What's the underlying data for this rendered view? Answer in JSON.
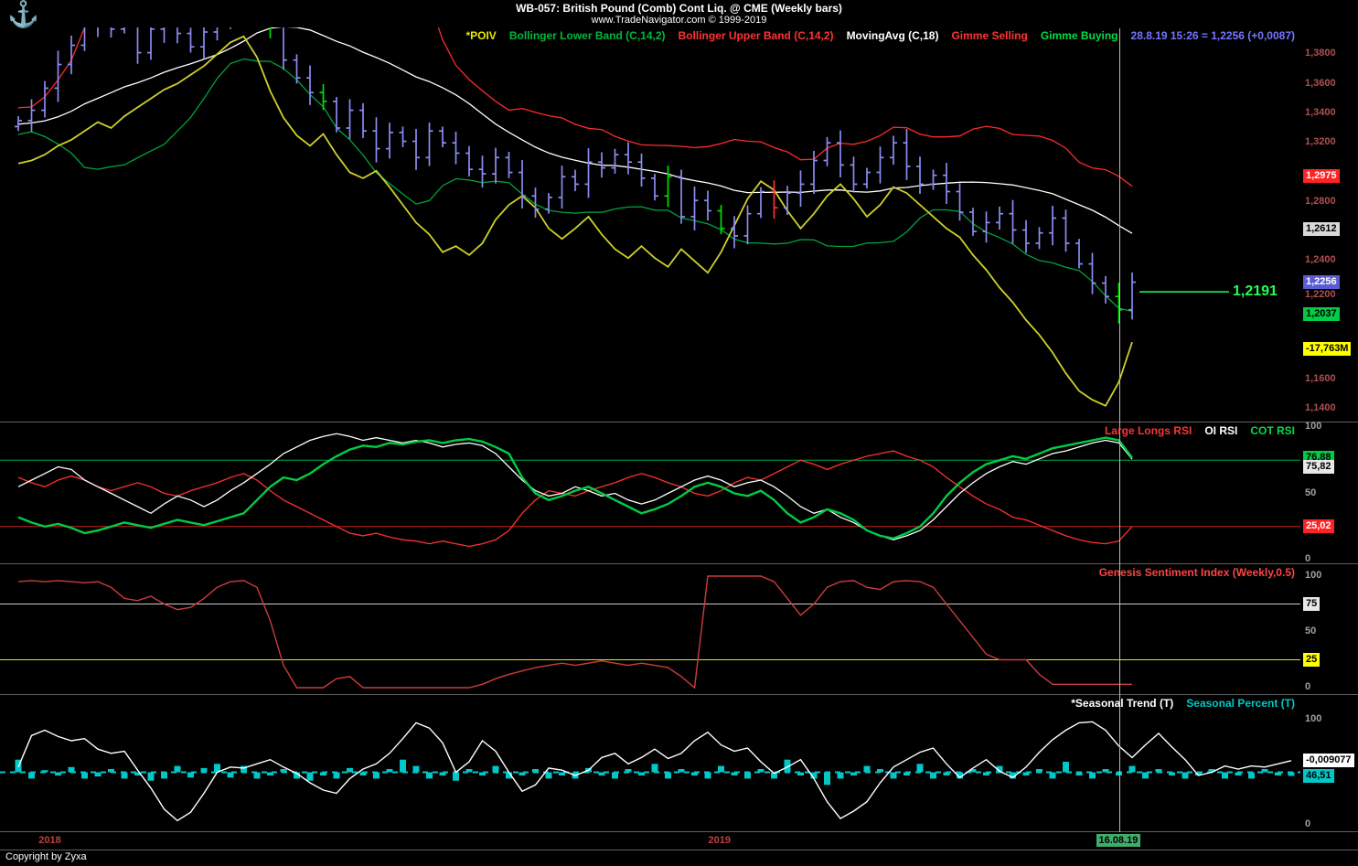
{
  "header": {
    "title": "WB-057:  British Pound (Comb) Cont Liq. @ CME  (Weekly bars)",
    "subtitle": "www.TradeNavigator.com © 1999-2019",
    "logo_glyph": "⚓"
  },
  "footer": {
    "copyright": "Copyright by Zyxa"
  },
  "x_axis": {
    "year_color": "#c04040",
    "years": [
      {
        "label": "2018",
        "index": 2.5
      },
      {
        "label": "2019",
        "index": 53
      }
    ],
    "cursor": {
      "label": "16.08.19",
      "index": 83,
      "badge_bg": "#3fae6a",
      "badge_fg": "#000000"
    }
  },
  "chart_data": [
    {
      "id": "price",
      "type": "ohlc",
      "title": "British Pound (Comb) Cont Liq. weekly bars with POIV, Bollinger Bands, MovingAvg, Gimme signals",
      "ylim": [
        1.135,
        1.395
      ],
      "legend": [
        {
          "label": "*POIV",
          "color": "#e8e800"
        },
        {
          "label": "Bollinger Lower Band (C,14,2)",
          "color": "#00b83c"
        },
        {
          "label": "Bollinger Upper Band (C,14,2)",
          "color": "#ff3333"
        },
        {
          "label": "MovingAvg (C,18)",
          "color": "#ffffff"
        },
        {
          "label": "Gimme Selling",
          "color": "#ff3333"
        },
        {
          "label": "Gimme Buying",
          "color": "#00dd44"
        },
        {
          "label": "28.8.19 15:26 = 1,2256 (+0,0087)",
          "color": "#7575ff"
        }
      ],
      "bar_color": "#8c8cf2",
      "buy_color": "#00e000",
      "sell_color": "#ff3232",
      "pre_closes": [
        1.322,
        1.327,
        1.331,
        1.324,
        1.319,
        1.326,
        1.332,
        1.328,
        1.335,
        1.33,
        1.338,
        1.334,
        1.34,
        1.336,
        1.339,
        1.343,
        1.333,
        1.337
      ],
      "closes": [
        1.335,
        1.342,
        1.357,
        1.373,
        1.386,
        1.416,
        1.4,
        1.397,
        1.405,
        1.381,
        1.397,
        1.403,
        1.394,
        1.385,
        1.395,
        1.4,
        1.409,
        1.424,
        1.434,
        1.4,
        1.376,
        1.364,
        1.354,
        1.348,
        1.33,
        1.342,
        1.328,
        1.316,
        1.327,
        1.321,
        1.31,
        1.328,
        1.32,
        1.313,
        1.302,
        1.299,
        1.31,
        1.3,
        1.284,
        1.275,
        1.283,
        1.297,
        1.292,
        1.307,
        1.303,
        1.312,
        1.307,
        1.296,
        1.284,
        1.297,
        1.27,
        1.281,
        1.274,
        1.262,
        1.257,
        1.272,
        1.287,
        1.276,
        1.286,
        1.292,
        1.308,
        1.32,
        1.305,
        1.292,
        1.3,
        1.31,
        1.32,
        1.304,
        1.292,
        1.298,
        1.287,
        1.273,
        1.26,
        1.266,
        1.272,
        1.261,
        1.252,
        1.259,
        1.269,
        1.252,
        1.238,
        1.225,
        1.216,
        1.207,
        1.2256
      ],
      "signals": {
        "buy": [
          19,
          23,
          49,
          53,
          83
        ],
        "sell": [
          57
        ]
      },
      "series": [
        {
          "name": "*POIV",
          "color": "#cfcf2a",
          "values": [
            1.306,
            1.308,
            1.312,
            1.318,
            1.322,
            1.328,
            1.334,
            1.33,
            1.338,
            1.344,
            1.35,
            1.356,
            1.36,
            1.366,
            1.372,
            1.38,
            1.388,
            1.392,
            1.378,
            1.355,
            1.337,
            1.325,
            1.318,
            1.326,
            1.312,
            1.3,
            1.296,
            1.301,
            1.29,
            1.278,
            1.266,
            1.258,
            1.246,
            1.25,
            1.244,
            1.252,
            1.268,
            1.278,
            1.284,
            1.276,
            1.262,
            1.255,
            1.262,
            1.27,
            1.258,
            1.248,
            1.242,
            1.25,
            1.242,
            1.236,
            1.248,
            1.24,
            1.232,
            1.246,
            1.264,
            1.282,
            1.294,
            1.288,
            1.274,
            1.262,
            1.272,
            1.284,
            1.292,
            1.282,
            1.27,
            1.278,
            1.29,
            1.286,
            1.278,
            1.27,
            1.262,
            1.256,
            1.244,
            1.234,
            1.222,
            1.212,
            1.2,
            1.19,
            1.178,
            1.164,
            1.152,
            1.146,
            1.142,
            1.158,
            1.185
          ]
        },
        {
          "name": "MovingAvg (C,18)",
          "color": "#ffffff",
          "derived": "sma",
          "period": 18
        },
        {
          "name": "Bollinger Upper Band (C,14,2)",
          "color": "#ff2a2a",
          "derived": "bollinger_upper",
          "period": 14,
          "mult": 2
        },
        {
          "name": "Bollinger Lower Band (C,14,2)",
          "color": "#00a33c",
          "derived": "bollinger_lower",
          "period": 14,
          "mult": 2
        }
      ],
      "hline": {
        "value": 1.2191,
        "label": "1,2191",
        "color": "#22ff55"
      },
      "axis": {
        "plain_color": "#b05050",
        "plain": [
          {
            "t": "1,3800",
            "v": 1.38
          },
          {
            "t": "1,3600",
            "v": 1.36
          },
          {
            "t": "1,3400",
            "v": 1.34
          },
          {
            "t": "1,3200",
            "v": 1.32
          },
          {
            "t": "1,2800",
            "v": 1.28
          },
          {
            "t": "1,2400",
            "v": 1.24
          },
          {
            "t": "1,2200",
            "v": 1.22,
            "dy": 5
          },
          {
            "t": "1,1600",
            "v": 1.16
          },
          {
            "t": "1,1400",
            "v": 1.14
          }
        ],
        "badges": [
          {
            "t": "1,2975",
            "v": 1.2975,
            "bg": "#ff2222",
            "fg": "#ffffff"
          },
          {
            "t": "1,2612",
            "v": 1.2612,
            "bg": "#d8d8d8",
            "fg": "#000000"
          },
          {
            "t": "1,2256",
            "v": 1.2256,
            "bg": "#5b5bd6",
            "fg": "#ffffff"
          },
          {
            "t": "1,2037",
            "v": 1.2037,
            "bg": "#00cc44",
            "fg": "#000000"
          },
          {
            "t": "-17,763M",
            "v": 1.1805,
            "bg": "#ffff00",
            "fg": "#000000"
          }
        ]
      }
    },
    {
      "id": "rsi",
      "type": "line",
      "ylim": [
        0,
        100
      ],
      "legend": [
        {
          "label": "Large Longs RSI",
          "color": "#ff3333"
        },
        {
          "label": "OI RSI",
          "color": "#ffffff"
        },
        {
          "label": "COT RSI",
          "color": "#00dd44"
        }
      ],
      "series": [
        {
          "name": "Large Longs RSI",
          "color": "#ff3030",
          "width": 1.3,
          "values": [
            62,
            58,
            55,
            60,
            63,
            60,
            55,
            52,
            55,
            58,
            55,
            50,
            48,
            52,
            55,
            58,
            62,
            65,
            60,
            52,
            45,
            40,
            35,
            30,
            25,
            20,
            18,
            20,
            17,
            15,
            14,
            12,
            14,
            12,
            10,
            12,
            15,
            22,
            35,
            45,
            52,
            50,
            48,
            52,
            55,
            58,
            62,
            65,
            62,
            58,
            55,
            50,
            48,
            52,
            58,
            62,
            60,
            65,
            70,
            75,
            72,
            68,
            72,
            75,
            78,
            80,
            82,
            78,
            75,
            70,
            62,
            55,
            48,
            42,
            38,
            32,
            30,
            26,
            22,
            18,
            15,
            13,
            12,
            14,
            25.02
          ]
        },
        {
          "name": "OI RSI",
          "color": "#ffffff",
          "width": 1.3,
          "values": [
            55,
            60,
            65,
            70,
            68,
            60,
            55,
            50,
            45,
            40,
            35,
            42,
            48,
            45,
            40,
            45,
            52,
            58,
            65,
            72,
            80,
            85,
            90,
            93,
            95,
            93,
            90,
            92,
            90,
            88,
            90,
            88,
            85,
            87,
            88,
            86,
            80,
            70,
            60,
            52,
            48,
            50,
            55,
            52,
            48,
            50,
            45,
            42,
            45,
            50,
            55,
            60,
            63,
            60,
            55,
            58,
            60,
            55,
            48,
            40,
            35,
            38,
            32,
            28,
            22,
            18,
            15,
            18,
            22,
            30,
            40,
            50,
            58,
            65,
            70,
            74,
            72,
            76,
            80,
            82,
            85,
            88,
            90,
            88,
            75.82
          ]
        },
        {
          "name": "COT RSI",
          "color": "#00cc44",
          "width": 2.4,
          "values": [
            32,
            28,
            25,
            27,
            24,
            20,
            22,
            25,
            28,
            26,
            24,
            27,
            30,
            28,
            26,
            29,
            32,
            35,
            45,
            55,
            62,
            60,
            65,
            72,
            78,
            83,
            86,
            85,
            88,
            87,
            89,
            90,
            88,
            90,
            91,
            89,
            85,
            80,
            62,
            50,
            45,
            48,
            52,
            55,
            50,
            45,
            40,
            35,
            38,
            42,
            48,
            55,
            58,
            55,
            50,
            48,
            52,
            45,
            35,
            28,
            32,
            38,
            35,
            30,
            22,
            18,
            16,
            20,
            25,
            35,
            48,
            58,
            66,
            72,
            75,
            78,
            76,
            80,
            84,
            86,
            88,
            90,
            92,
            90,
            76.88
          ]
        }
      ],
      "hlines": [
        {
          "v": 75,
          "color": "#00aa44"
        },
        {
          "v": 25,
          "color": "#cc2222"
        }
      ],
      "axis": {
        "plain_color": "#a0a0a0",
        "plain": [
          {
            "t": "100",
            "v": 100
          },
          {
            "t": "50",
            "v": 50
          },
          {
            "t": "0",
            "v": 0
          }
        ],
        "badges": [
          {
            "t": "76,88",
            "v": 76.88,
            "bg": "#00cc44",
            "fg": "#000000"
          },
          {
            "t": "75,82",
            "v": 75.82,
            "bg": "#e8e8e8",
            "fg": "#000000",
            "dy": 9
          },
          {
            "t": "25,02",
            "v": 25.02,
            "bg": "#ff2222",
            "fg": "#ffffff"
          }
        ]
      }
    },
    {
      "id": "sentiment",
      "type": "line",
      "ylim": [
        0,
        100
      ],
      "legend": [
        {
          "label": "Genesis Sentiment Index (Weekly,0.5)",
          "color": "#ff4444"
        }
      ],
      "series": [
        {
          "name": "Genesis Sentiment Index (Weekly,0.5)",
          "color": "#cc3c3c",
          "width": 1.4,
          "values": [
            95,
            96,
            95,
            96,
            95,
            94,
            95,
            90,
            80,
            78,
            82,
            75,
            70,
            72,
            80,
            90,
            95,
            96,
            90,
            60,
            20,
            0,
            0,
            0,
            8,
            10,
            0,
            0,
            0,
            0,
            0,
            0,
            0,
            0,
            0,
            3,
            8,
            12,
            15,
            18,
            20,
            22,
            20,
            22,
            24,
            22,
            20,
            22,
            20,
            18,
            10,
            0,
            100,
            100,
            100,
            100,
            100,
            95,
            80,
            65,
            75,
            90,
            95,
            96,
            90,
            88,
            95,
            96,
            95,
            90,
            75,
            60,
            45,
            30,
            25,
            25,
            25,
            12,
            3,
            3,
            3,
            3,
            3,
            3,
            3
          ]
        }
      ],
      "hlines": [
        {
          "v": 75,
          "color": "#cccccc"
        },
        {
          "v": 25,
          "color": "#e8e800"
        }
      ],
      "axis": {
        "plain_color": "#a0a0a0",
        "plain": [
          {
            "t": "100",
            "v": 100
          },
          {
            "t": "50",
            "v": 50
          },
          {
            "t": "0",
            "v": 0
          }
        ],
        "badges": [
          {
            "t": "75",
            "v": 75,
            "bg": "#e8e8e8",
            "fg": "#000000"
          },
          {
            "t": "25",
            "v": 25,
            "bg": "#ffff00",
            "fg": "#000000"
          }
        ]
      }
    },
    {
      "id": "seasonal",
      "type": "line+bar",
      "ylim": [
        0,
        100
      ],
      "legend": [
        {
          "label": "*Seasonal Trend (T)",
          "color": "#ffffff"
        },
        {
          "label": "Seasonal Percent (T)",
          "color": "#00c8c8"
        }
      ],
      "baseline": {
        "v": 50,
        "color": "#00c8c8"
      },
      "trend": {
        "name": "*Seasonal Trend (T)",
        "color": "#ffffff",
        "values": [
          55,
          85,
          90,
          84,
          80,
          82,
          72,
          68,
          70,
          52,
          35,
          15,
          4,
          12,
          30,
          50,
          55,
          54,
          58,
          62,
          55,
          49,
          40,
          33,
          30,
          44,
          53,
          58,
          68,
          82,
          97,
          92,
          78,
          50,
          60,
          80,
          70,
          50,
          32,
          38,
          54,
          52,
          47,
          52,
          64,
          68,
          58,
          64,
          72,
          63,
          68,
          80,
          88,
          76,
          70,
          73,
          60,
          49,
          55,
          62,
          44,
          22,
          6,
          13,
          22,
          40,
          55,
          62,
          69,
          73,
          58,
          45,
          54,
          62,
          51,
          45,
          55,
          69,
          81,
          90,
          97,
          98,
          90,
          75,
          64,
          76,
          87,
          74,
          62,
          47,
          50,
          56,
          53,
          56,
          55,
          58,
          61
        ]
      },
      "percent": {
        "name": "Seasonal Percent (T)",
        "color": "#00c8c8",
        "values": [
          62,
          44,
          52,
          47,
          55,
          44,
          46,
          53,
          44,
          47,
          42,
          44,
          56,
          45,
          54,
          58,
          45,
          56,
          44,
          47,
          53,
          44,
          42,
          47,
          44,
          54,
          47,
          44,
          53,
          62,
          56,
          44,
          47,
          42,
          53,
          47,
          56,
          44,
          47,
          53,
          44,
          47,
          44,
          54,
          47,
          44,
          53,
          47,
          58,
          44,
          53,
          47,
          44,
          56,
          47,
          44,
          53,
          44,
          62,
          47,
          44,
          38,
          44,
          47,
          56,
          53,
          44,
          47,
          58,
          44,
          47,
          44,
          53,
          47,
          56,
          44,
          47,
          53,
          44,
          60,
          47,
          44,
          53,
          47,
          56,
          44,
          53,
          47,
          44,
          47,
          53,
          44,
          47,
          44,
          53,
          47,
          46.51
        ]
      },
      "axis": {
        "plain_color": "#a0a0a0",
        "plain": [
          {
            "t": "100",
            "v": 100
          },
          {
            "t": "0",
            "v": 0
          }
        ],
        "badges": [
          {
            "t": "-0,009077",
            "v": 61,
            "bg": "#ffffff",
            "fg": "#000000"
          },
          {
            "t": "46,51",
            "v": 46.51,
            "bg": "#00c8c8",
            "fg": "#000000"
          }
        ]
      }
    }
  ]
}
